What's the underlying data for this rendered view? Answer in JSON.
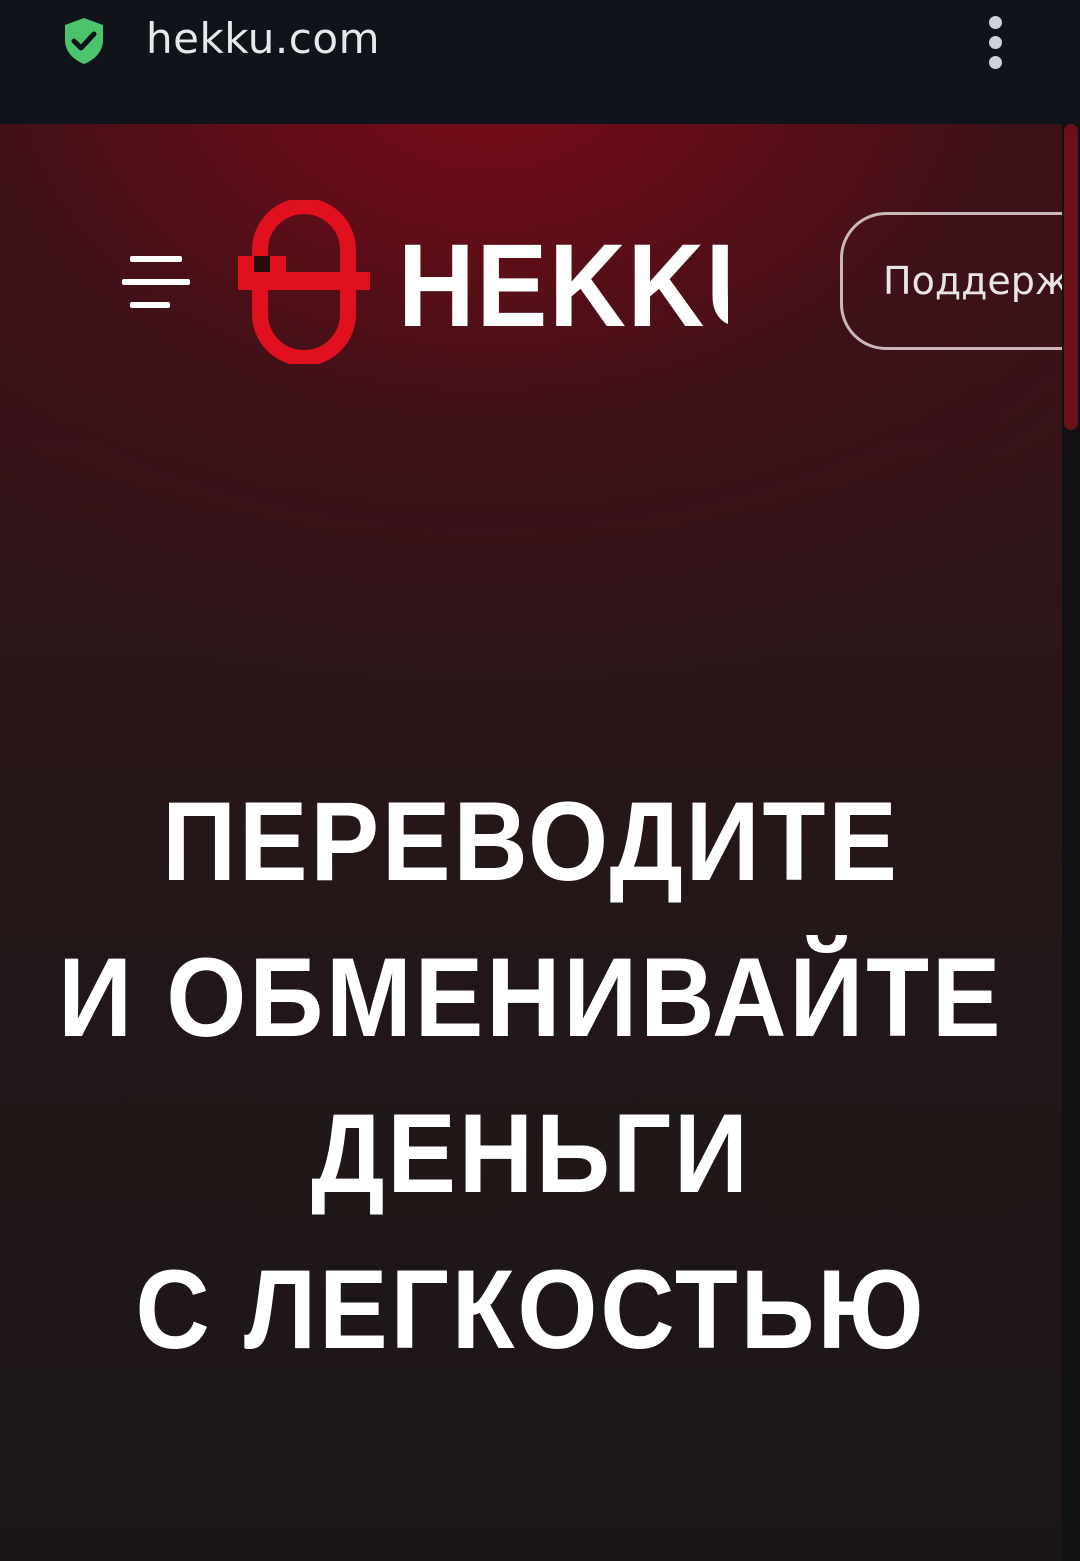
{
  "browser": {
    "url": "hekku.com",
    "security_icon": "shield-check-icon",
    "menu_icon": "kebab-menu-icon",
    "shield_color": "#4cc46b"
  },
  "header": {
    "menu_icon": "hamburger-icon",
    "logo_text": "HEKKU",
    "logo_color": "#e0101e",
    "support_button_label": "Поддерж"
  },
  "hero": {
    "lines": [
      "ПЕРЕВОДИТЕ",
      "И ОБМЕНИВАЙТЕ",
      "ДЕНЬГИ",
      "С ЛЕГКОСТЬЮ"
    ]
  },
  "colors": {
    "accent": "#7a0c18",
    "browser_bar": "#10131a",
    "text": "#ffffff"
  }
}
